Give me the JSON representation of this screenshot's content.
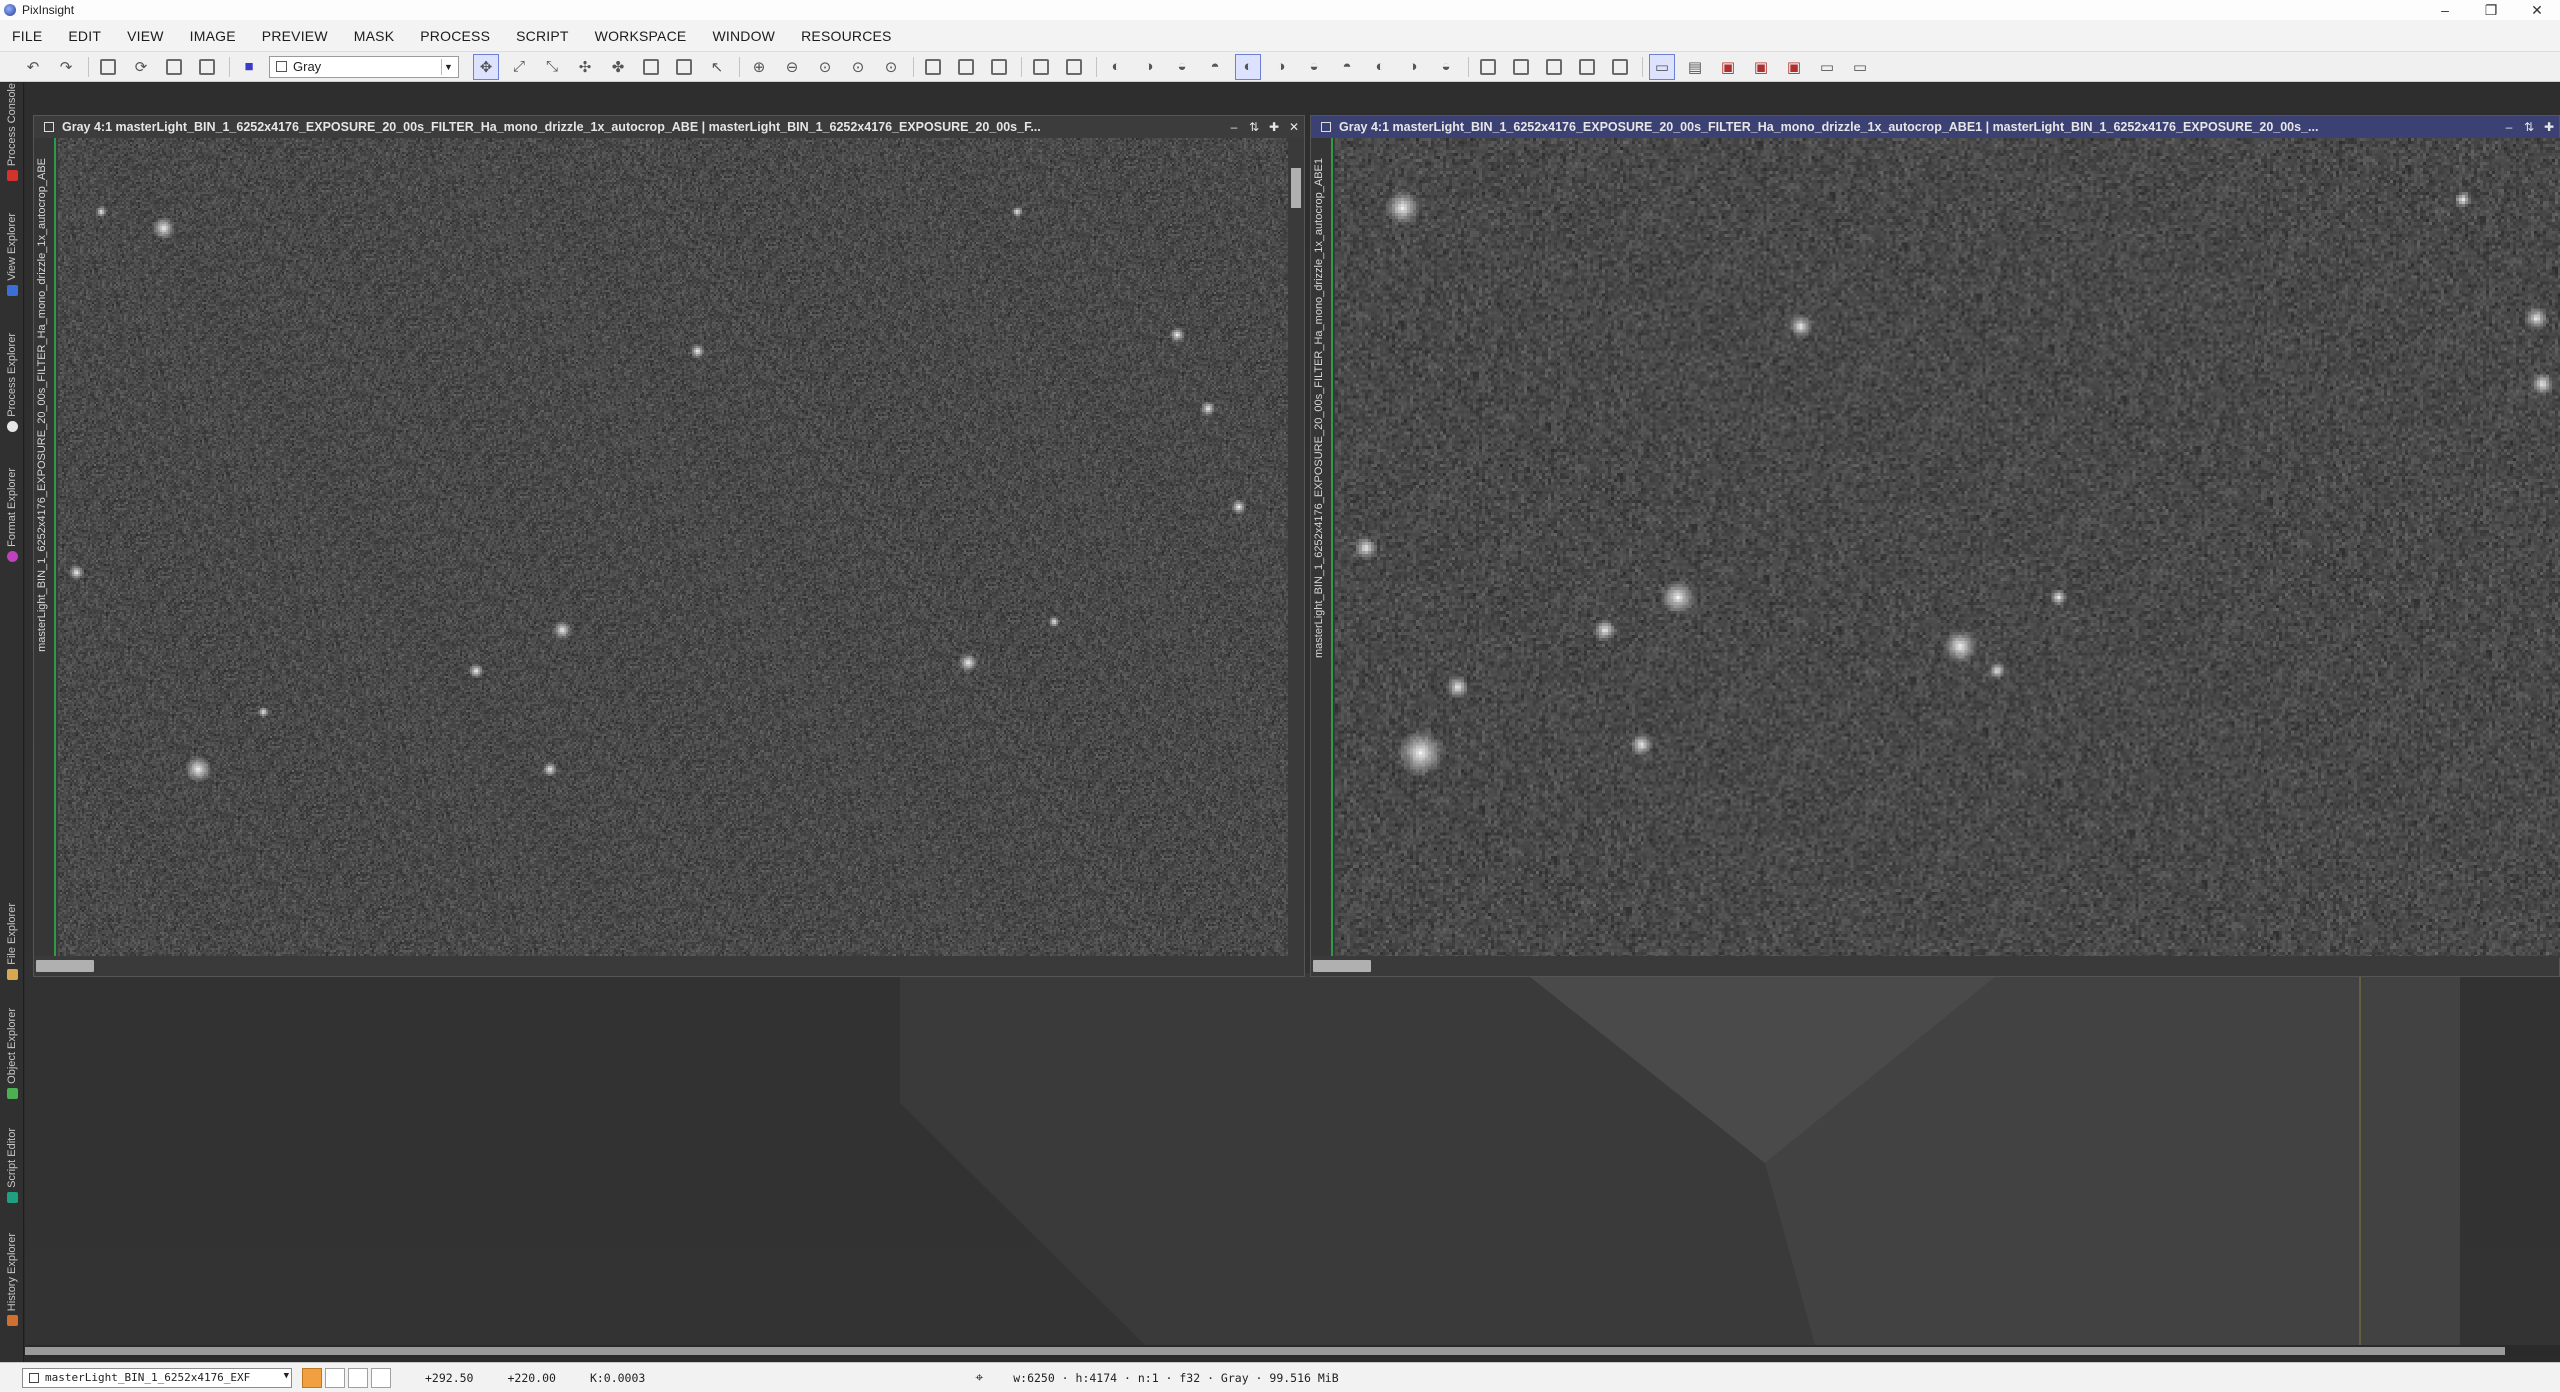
{
  "app": {
    "title": "PixInsight"
  },
  "window_controls": {
    "minimize": "–",
    "maximize": "❐",
    "close": "✕"
  },
  "menu": [
    "FILE",
    "EDIT",
    "VIEW",
    "IMAGE",
    "PREVIEW",
    "MASK",
    "PROCESS",
    "SCRIPT",
    "WORKSPACE",
    "WINDOW",
    "RESOURCES"
  ],
  "toolbar": {
    "channel_select": "Gray",
    "undo_icon": "undo-icon",
    "redo_icon": "redo-icon"
  },
  "left_dock": {
    "tabs": [
      {
        "label": "Process Console",
        "color": "#d0342c"
      },
      {
        "label": "View Explorer",
        "color": "#3a6fd8"
      },
      {
        "label": "Process Explorer",
        "color": "#e6e6e6"
      },
      {
        "label": "Format Explorer",
        "color": "#c040c0"
      },
      {
        "label": "File Explorer",
        "color": "#d8a850"
      },
      {
        "label": "Object Explorer",
        "color": "#4caf50"
      },
      {
        "label": "Script Editor",
        "color": "#20a080"
      },
      {
        "label": "History Explorer",
        "color": "#d07030"
      }
    ]
  },
  "windows": [
    {
      "title": "Gray 4:1 masterLight_BIN_1_6252x4176_EXPOSURE_20_00s_FILTER_Ha_mono_drizzle_1x_autocrop_ABE | masterLight_BIN_1_6252x4176_EXPOSURE_20_00s_F...",
      "view_id": "masterLight_BIN_1_6252x4176_EXPOSURE_20_00s_FILTER_Ha_mono_drizzle_1x_autocrop_ABE",
      "active": false
    },
    {
      "title": "Gray 4:1 masterLight_BIN_1_6252x4176_EXPOSURE_20_00s_FILTER_Ha_mono_drizzle_1x_autocrop_ABE1 | masterLight_BIN_1_6252x4176_EXPOSURE_20_00s_...",
      "view_id": "masterLight_BIN_1_6252x4176_EXPOSURE_20_00s_FILTER_Ha_mono_drizzle_1x_autocrop_ABE1",
      "active": true
    }
  ],
  "statusbar": {
    "view_select": "masterLight_BIN_1_6252x4176_EXF",
    "x": "+292.50",
    "y": "+220.00",
    "k": "K:0.0003",
    "info": "w:6250 · h:4174 · n:1 · f32 · Gray · 99.516 MiB"
  }
}
